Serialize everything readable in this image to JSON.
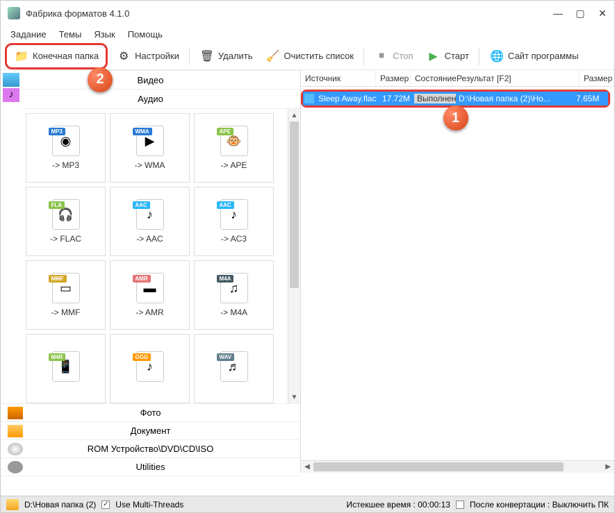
{
  "window": {
    "title": "Фабрика форматов 4.1.0"
  },
  "menu": {
    "items": [
      "Задание",
      "Темы",
      "Язык",
      "Помощь"
    ]
  },
  "toolbar": {
    "output_folder": "Конечная папка",
    "settings": "Настройки",
    "delete": "Удалить",
    "clear_list": "Очистить список",
    "stop": "Стоп",
    "start": "Старт",
    "site": "Сайт программы"
  },
  "callouts": {
    "one": "1",
    "two": "2"
  },
  "categories": {
    "video": "Видео",
    "audio": "Аудио",
    "photo": "Фото",
    "document": "Документ",
    "rom": "ROM Устройство\\DVD\\CD\\ISO",
    "utilities": "Utilities"
  },
  "formats": [
    {
      "tag": "MP3",
      "color": "#2a7bd4",
      "glyph": "◉",
      "label": "-> MP3"
    },
    {
      "tag": "WMA",
      "color": "#2a7bd4",
      "glyph": "▶",
      "label": "-> WMA"
    },
    {
      "tag": "APE",
      "color": "#8bc34a",
      "glyph": "🐵",
      "label": "-> APE"
    },
    {
      "tag": "FLA",
      "color": "#8bc34a",
      "glyph": "🎧",
      "label": "-> FLAC"
    },
    {
      "tag": "AAC",
      "color": "#29b6f6",
      "glyph": "♪",
      "label": "-> AAC"
    },
    {
      "tag": "AAC",
      "color": "#29b6f6",
      "glyph": "♪",
      "label": "-> AC3"
    },
    {
      "tag": "MMF",
      "color": "#d4a72a",
      "glyph": "▭",
      "label": "-> MMF"
    },
    {
      "tag": "AMR",
      "color": "#e57373",
      "glyph": "▬",
      "label": "-> AMR"
    },
    {
      "tag": "M4A",
      "color": "#455a64",
      "glyph": "♫",
      "label": "-> M4A"
    },
    {
      "tag": "M4R",
      "color": "#8bc34a",
      "glyph": "📱",
      "label": ""
    },
    {
      "tag": "OGG",
      "color": "#ff9800",
      "glyph": "♪",
      "label": ""
    },
    {
      "tag": "WAV",
      "color": "#607d8b",
      "glyph": "♬",
      "label": ""
    }
  ],
  "list_header": {
    "source": "Источник",
    "size": "Размер",
    "state": "Состояние",
    "result": "Результат [F2]",
    "size2": "Размер"
  },
  "list_rows": [
    {
      "source": "Sleep Away.flac",
      "size": "17.72M",
      "state": "Выполнено",
      "result": "D:\\Новая папка (2)\\Но...",
      "size2": "7.65M"
    }
  ],
  "statusbar": {
    "path": "D:\\Новая папка (2)",
    "multi_threads": "Use Multi-Threads",
    "elapsed": "Истекшее время : 00:00:13",
    "after_conv": "После конвертации : Выключить ПК"
  }
}
